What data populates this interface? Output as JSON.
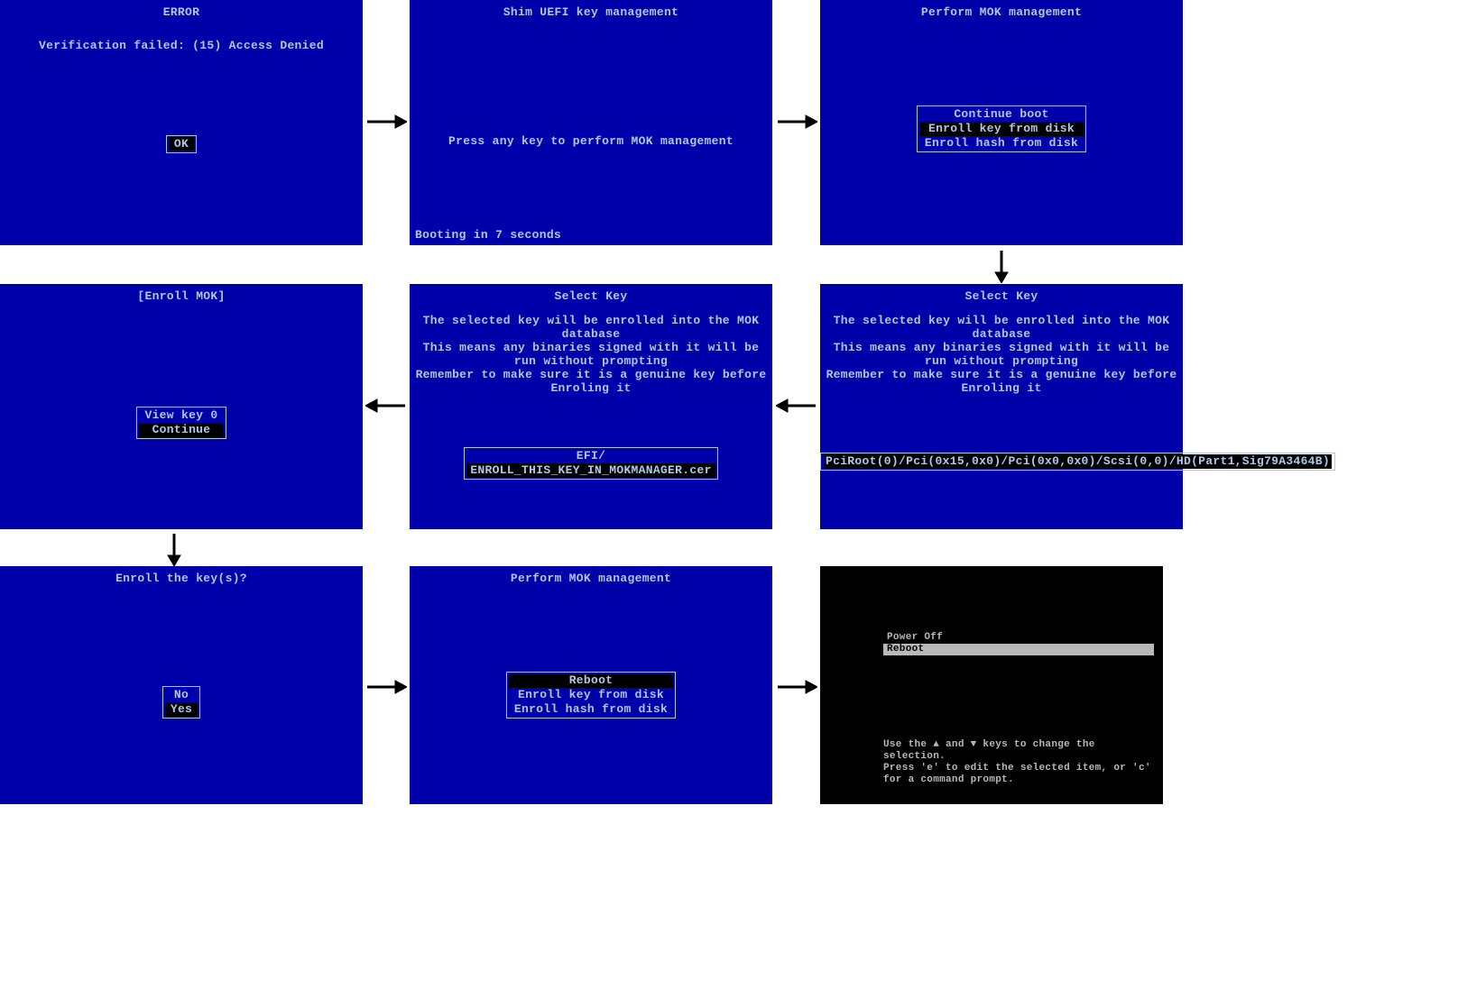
{
  "screens": {
    "s1": {
      "title": "ERROR",
      "message": "Verification failed: (15) Access Denied",
      "ok": "OK"
    },
    "s2": {
      "title": "Shim UEFI key management",
      "message": "Press any key to perform MOK management",
      "footer": "Booting in 7 seconds"
    },
    "s3": {
      "title": "Perform MOK management",
      "items": {
        "continue": "Continue boot",
        "enroll_key": "Enroll key from disk",
        "enroll_hash": "Enroll hash from disk"
      }
    },
    "s4": {
      "title": "Select Key",
      "line1": "The selected key will be enrolled into the MOK database",
      "line2": "This means any binaries signed with it will be run without prompting",
      "line3": "Remember to make sure it is a genuine key before Enroling it",
      "path": "PciRoot(0)/Pci(0x15,0x0)/Pci(0x0,0x0)/Scsi(0,0)/HD(Part1,Sig79A3464B)"
    },
    "s5": {
      "title": "Select Key",
      "line1": "The selected key will be enrolled into the MOK database",
      "line2": "This means any binaries signed with it will be run without prompting",
      "line3": "Remember to make sure it is a genuine key before Enroling it",
      "path1": "EFI/",
      "path2": "ENROLL_THIS_KEY_IN_MOKMANAGER.cer"
    },
    "s6": {
      "title": "[Enroll MOK]",
      "view": "View key 0",
      "cont": "Continue"
    },
    "s7": {
      "title": "Enroll the key(s)?",
      "no": "No",
      "yes": "Yes"
    },
    "s8": {
      "title": "Perform MOK management",
      "items": {
        "reboot": "Reboot",
        "enroll_key": "Enroll key from disk",
        "enroll_hash": "Enroll hash from disk"
      }
    },
    "s9": {
      "poweroff": "Power Off",
      "reboot": "Reboot",
      "hint1": "Use the ▲ and ▼ keys to change the selection.",
      "hint2": "Press 'e' to edit the selected item, or 'c' for a command prompt."
    }
  }
}
